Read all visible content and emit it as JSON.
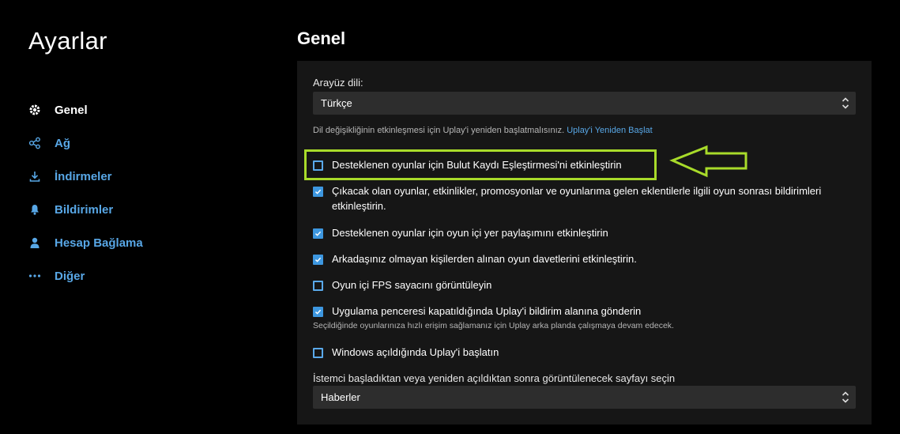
{
  "app": {
    "title": "Ayarlar"
  },
  "sidebar": {
    "items": [
      {
        "label": "Genel",
        "icon": "gear-icon",
        "active": true
      },
      {
        "label": "Ağ",
        "icon": "network-icon",
        "active": false
      },
      {
        "label": "İndirmeler",
        "icon": "download-icon",
        "active": false
      },
      {
        "label": "Bildirimler",
        "icon": "bell-icon",
        "active": false
      },
      {
        "label": "Hesap Bağlama",
        "icon": "user-icon",
        "active": false
      },
      {
        "label": "Diğer",
        "icon": "ellipsis-icon",
        "active": false
      }
    ]
  },
  "main": {
    "section_title": "Genel",
    "language": {
      "label": "Arayüz dili:",
      "value": "Türkçe",
      "hint": "Dil değişikliğinin etkinleşmesi için Uplay'i yeniden başlatmalısınız.",
      "restart_link": "Uplay'i Yeniden Başlat"
    },
    "options": [
      {
        "label": "Desteklenen oyunlar için Bulut Kaydı Eşleştirmesi'ni etkinleştirin",
        "checked": false
      },
      {
        "label": "Çıkacak olan oyunlar, etkinlikler, promosyonlar ve oyunlarıma gelen eklentilerle ilgili oyun sonrası bildirimleri etkinleştirin.",
        "checked": true
      },
      {
        "label": "Desteklenen oyunlar için oyun içi yer paylaşımını etkinleştirin",
        "checked": true
      },
      {
        "label": "Arkadaşınız olmayan kişilerden alınan oyun davetlerini etkinleştirin.",
        "checked": true
      },
      {
        "label": "Oyun içi FPS sayacını görüntüleyin",
        "checked": false
      },
      {
        "label": "Uygulama penceresi kapatıldığında Uplay'i bildirim alanına gönderin",
        "checked": true,
        "sub": "Seçildiğinde oyunlarınıza hızlı erişim sağlamanız için Uplay arka planda çalışmaya devam edecek."
      },
      {
        "label": "Windows açıldığında Uplay'i başlatın",
        "checked": false
      }
    ],
    "start_page": {
      "label": "İstemci başladıktan veya yeniden açıldıktan sonra görüntülenecek sayfayı seçin",
      "value": "Haberler"
    }
  },
  "colors": {
    "accent": "#58a7e6",
    "checkbox": "#3d97e0",
    "highlight": "#a8db2a",
    "panel": "#161616",
    "background": "#000000"
  }
}
